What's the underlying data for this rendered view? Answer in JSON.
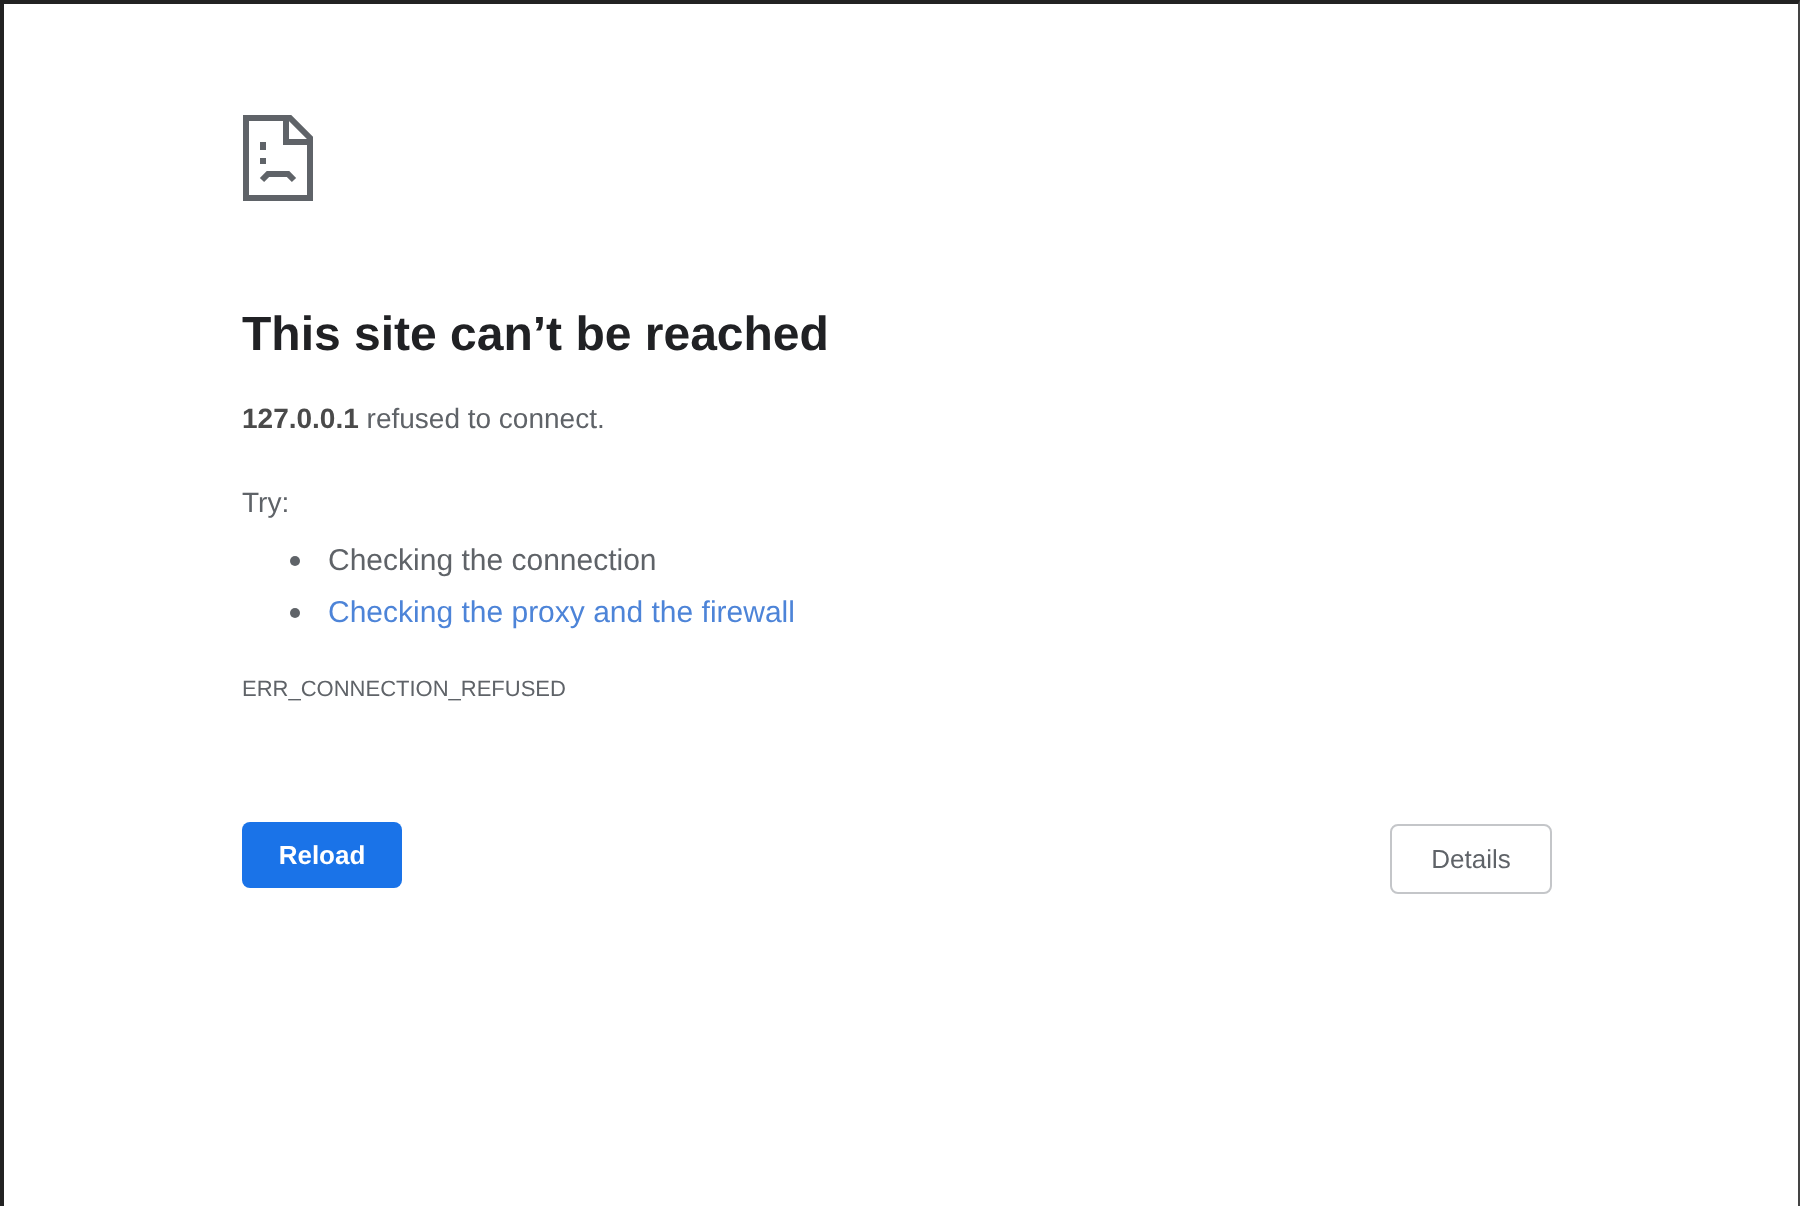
{
  "heading": "This site can’t be reached",
  "message": "**127.0.0.1** refused to connect.",
  "try_label": "Try:",
  "suggestions": [
    {
      "kind": "text",
      "text": "Checking the connection"
    },
    {
      "kind": "link",
      "text": "Checking the proxy and the firewall"
    }
  ],
  "error_code": "ERR_CONNECTION_REFUSED",
  "buttons": [
    {
      "kind": "primary",
      "label": "Reload"
    },
    {
      "kind": "secondary",
      "label": "Details"
    }
  ]
}
